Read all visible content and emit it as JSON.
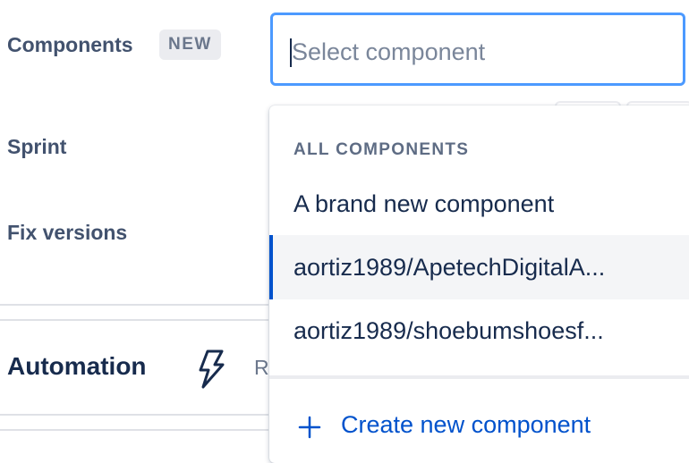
{
  "fields": {
    "components_label": "Components",
    "components_badge": "NEW",
    "sprint_label": "Sprint",
    "fix_versions_label": "Fix versions"
  },
  "automation": {
    "title": "Automation",
    "partial_text": "R",
    "icon": "lightning-bolt-icon"
  },
  "select": {
    "placeholder": "Select component"
  },
  "dropdown": {
    "group_heading": "ALL COMPONENTS",
    "options": [
      {
        "label": "A brand new component",
        "focused": false
      },
      {
        "label": "aortiz1989/ApetechDigitalA...",
        "focused": true
      },
      {
        "label": "aortiz1989/shoebumshoesf...",
        "focused": false
      }
    ],
    "create_label": "Create new component",
    "create_icon": "plus-icon"
  },
  "colors": {
    "accent": "#0052cc",
    "focus_border": "#4c9aff",
    "label_text": "#42526e",
    "badge_bg": "#ebecf0",
    "option_hover_bg": "#f4f5f7"
  }
}
